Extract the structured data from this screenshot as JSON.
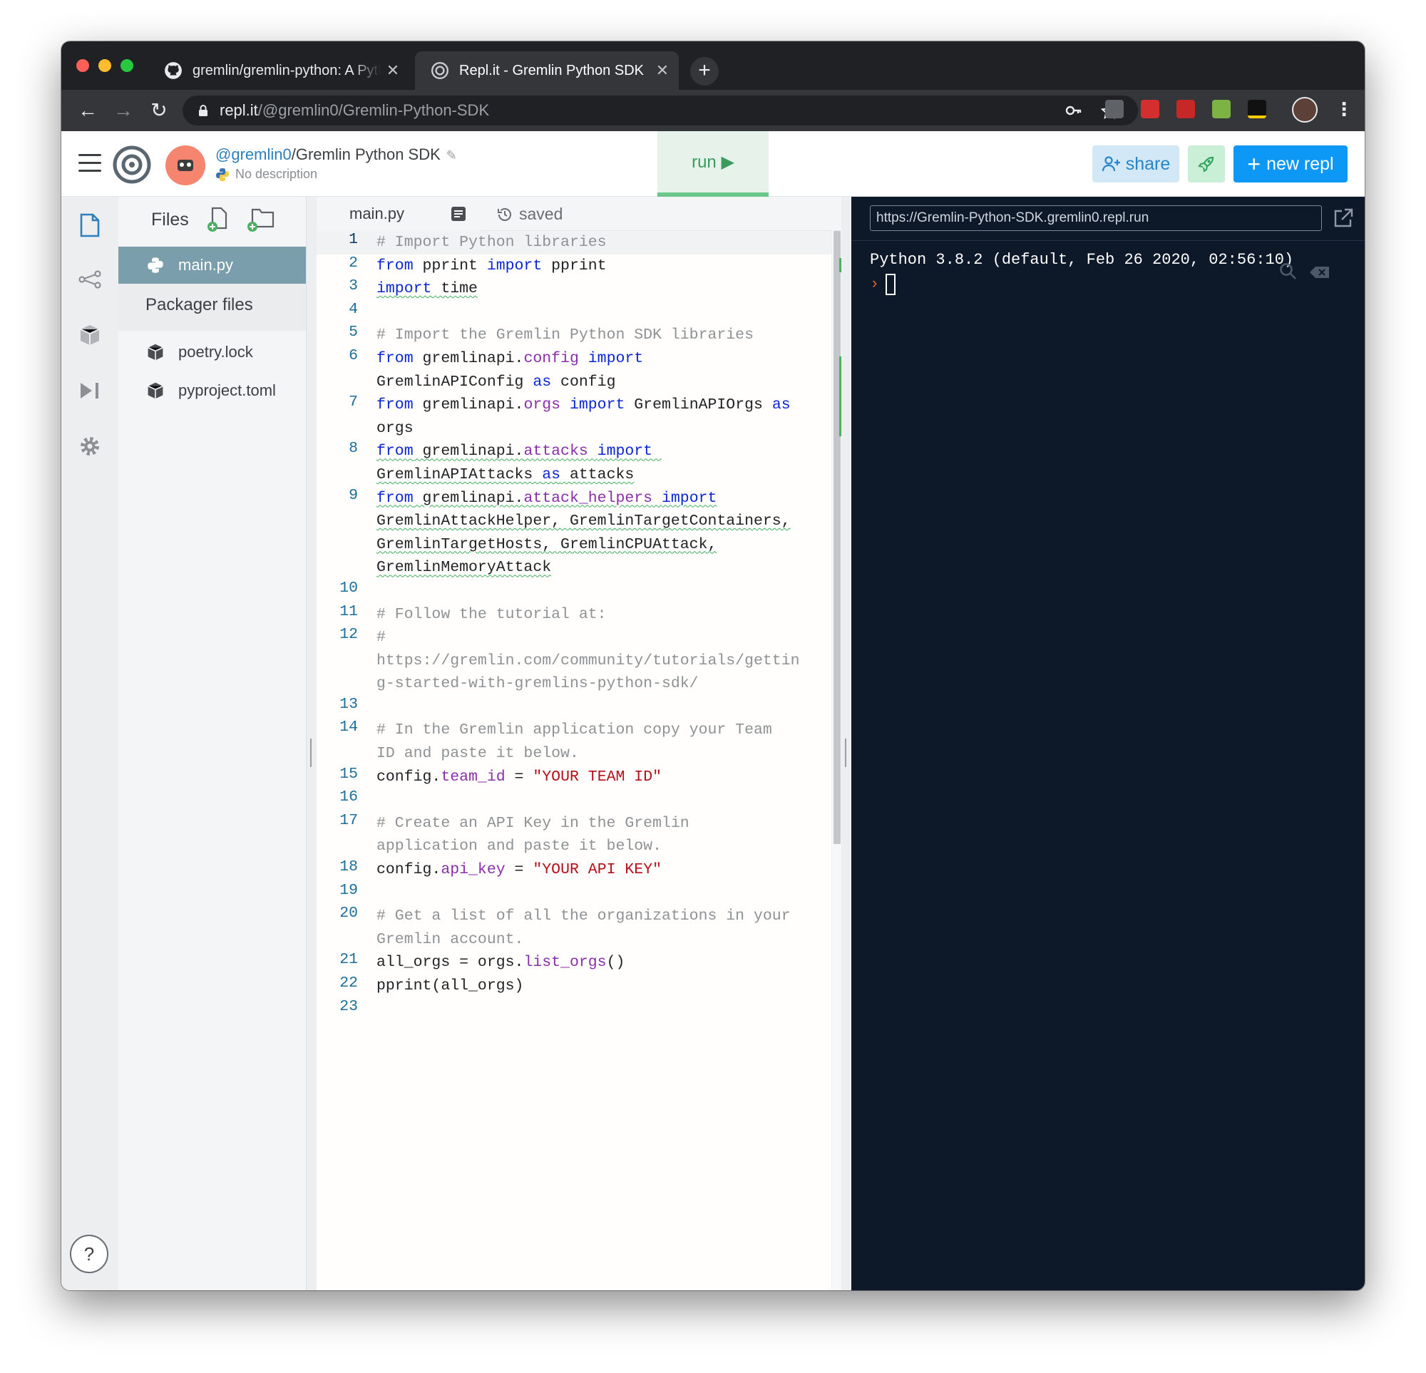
{
  "browser": {
    "tabs": [
      {
        "title": "gremlin/gremlin-python: A Python",
        "icon": "github-icon",
        "active": false
      },
      {
        "title": "Repl.it - Gremlin Python SDK",
        "icon": "replit-icon",
        "active": true
      }
    ],
    "new_tab_label": "+",
    "address": {
      "host": "repl.it",
      "path": "/@gremlin0/Gremlin-Python-SDK"
    }
  },
  "header": {
    "owner": "@gremlin0",
    "separator": "/",
    "repl_name": "Gremlin Python SDK",
    "description": "No description",
    "run_label": "run ▶",
    "share_label": "share",
    "new_repl_label": "new repl"
  },
  "files": {
    "title": "Files",
    "items": [
      {
        "name": "main.py",
        "icon": "python-icon",
        "active": true
      }
    ],
    "packager_title": "Packager files",
    "packager_items": [
      {
        "name": "poetry.lock",
        "icon": "package-icon"
      },
      {
        "name": "pyproject.toml",
        "icon": "package-icon"
      }
    ]
  },
  "editor": {
    "tab_name": "main.py",
    "status": "saved",
    "lines": [
      {
        "n": "1",
        "text": "# Import Python libraries"
      },
      {
        "n": "2",
        "text": "from pprint import pprint"
      },
      {
        "n": "3",
        "text": "import time"
      },
      {
        "n": "4",
        "text": ""
      },
      {
        "n": "5",
        "text": "# Import the Gremlin Python SDK libraries"
      },
      {
        "n": "6",
        "text": "from gremlinapi.config import GremlinAPIConfig as config"
      },
      {
        "n": "7",
        "text": "from gremlinapi.orgs import GremlinAPIOrgs as orgs"
      },
      {
        "n": "8",
        "text": "from gremlinapi.attacks import GremlinAPIAttacks as attacks"
      },
      {
        "n": "9",
        "text": "from gremlinapi.attack_helpers import GremlinAttackHelper, GremlinTargetContainers, GremlinTargetHosts, GremlinCPUAttack, GremlinMemoryAttack"
      },
      {
        "n": "10",
        "text": ""
      },
      {
        "n": "11",
        "text": "# Follow the tutorial at:"
      },
      {
        "n": "12",
        "text": "# https://gremlin.com/community/tutorials/getting-started-with-gremlins-python-sdk/"
      },
      {
        "n": "13",
        "text": ""
      },
      {
        "n": "14",
        "text": "# In the Gremlin application copy your Team ID and paste it below."
      },
      {
        "n": "15",
        "text": "config.team_id = \"YOUR TEAM ID\""
      },
      {
        "n": "16",
        "text": ""
      },
      {
        "n": "17",
        "text": "# Create an API Key in the Gremlin application and paste it below."
      },
      {
        "n": "18",
        "text": "config.api_key = \"YOUR API KEY\""
      },
      {
        "n": "19",
        "text": ""
      },
      {
        "n": "20",
        "text": "# Get a list of all the organizations in your Gremlin account."
      },
      {
        "n": "21",
        "text": "all_orgs = orgs.list_orgs()"
      },
      {
        "n": "22",
        "text": "pprint(all_orgs)"
      },
      {
        "n": "23",
        "text": ""
      }
    ]
  },
  "console": {
    "url": "https://Gremlin-Python-SDK.gremlin0.repl.run",
    "output": "Python 3.8.2 (default, Feb 26 2020, 02:56:10)",
    "prompt": "›"
  },
  "help_label": "?",
  "colors": {
    "run": "#6cc68b",
    "new_repl": "#0d98f5",
    "console_bg": "#0d1829",
    "active_file": "#7a9eab"
  }
}
